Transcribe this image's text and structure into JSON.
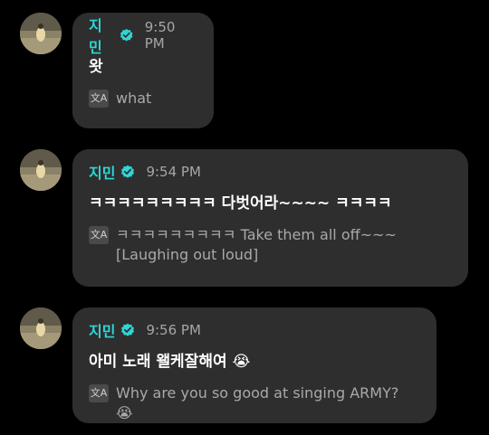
{
  "messages": [
    {
      "author": "지민",
      "time": "9:50 PM",
      "text": "왓",
      "translation_icon": "translate-icon",
      "translation": "what"
    },
    {
      "author": "지민",
      "time": "9:54 PM",
      "text": "ㅋㅋㅋㅋㅋㅋㅋㅋㅋ 다벗어라~~~~ ㅋㅋㅋㅋ",
      "translation_icon": "translate-icon",
      "translation": "ㅋㅋㅋㅋㅋㅋㅋㅋㅋ Take them all off~~~ [Laughing out loud]"
    },
    {
      "author": "지민",
      "time": "9:56 PM",
      "text": "아미 노래 왤케잘해여 😭",
      "translation_icon": "translate-icon",
      "translation": "Why are you so good at singing ARMY? 😭"
    }
  ],
  "colors": {
    "background": "#000000",
    "bubble": "#2e2e2e",
    "author": "#2ed6d6",
    "verified_badge": "#2ed6d6",
    "time": "#a6a6a6",
    "translation": "#a9a9a9"
  }
}
